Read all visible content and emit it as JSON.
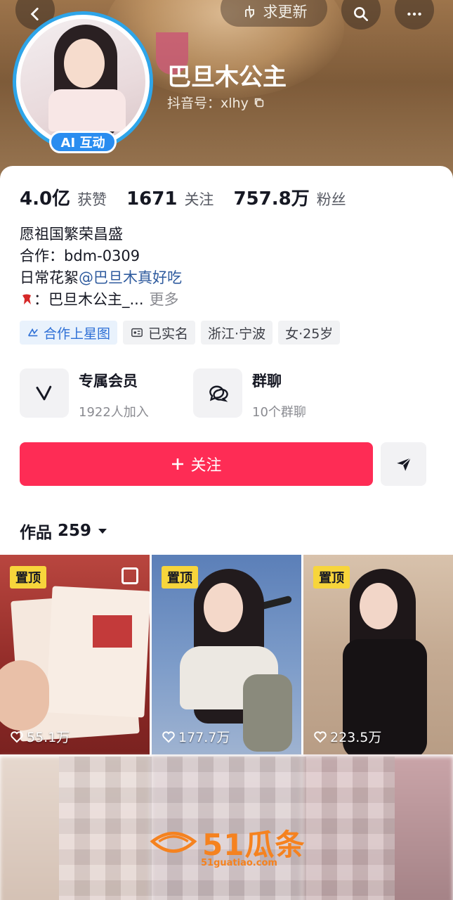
{
  "header": {
    "pill_label": "求更新",
    "nickname": "巴旦木公主",
    "douyin_id": "抖音号：xlhy",
    "ai_badge": "AI 互动"
  },
  "stats": [
    {
      "num": "4.0亿",
      "label": "获赞"
    },
    {
      "num": "1671",
      "label": "关注"
    },
    {
      "num": "757.8万",
      "label": "粉丝"
    }
  ],
  "bio": {
    "line1": "愿祖国繁荣昌盛",
    "line2": "合作：bdm-0309",
    "line3_prefix": "日常花絮",
    "line3_link": "@巴旦木真好吃",
    "line4_text": "：巴旦木公主_...",
    "more": "更多"
  },
  "tags": {
    "star": "合作上星图",
    "verified": "已实名",
    "location": "浙江·宁波",
    "gender_age": "女·25岁"
  },
  "features": {
    "member_title": "专属会员",
    "member_sub": "1922人加入",
    "group_title": "群聊",
    "group_sub": "10个群聊"
  },
  "follow_label": "关注",
  "works": {
    "label": "作品",
    "count": "259"
  },
  "tiles": [
    {
      "pin": "置顶",
      "likes": "55.1万"
    },
    {
      "pin": "置顶",
      "likes": "177.7万"
    },
    {
      "pin": "置顶",
      "likes": "223.5万"
    }
  ],
  "watermark": {
    "logo": "51瓜条",
    "url": "51guatiao.com"
  },
  "icons": [
    "back-icon",
    "hand-icon",
    "search-icon",
    "more-icon",
    "copy-icon",
    "star-map-icon",
    "id-card-icon",
    "vip-v-icon",
    "chat-bubble-icon",
    "plus-icon",
    "share-send-icon",
    "caret-down-icon",
    "heart-icon",
    "multi-image-icon"
  ],
  "colors": {
    "accent": "#fe2c55",
    "avatar_ring": "#2ea5e9",
    "pin_badge": "#f7d53b",
    "link": "#2f5b9e"
  }
}
